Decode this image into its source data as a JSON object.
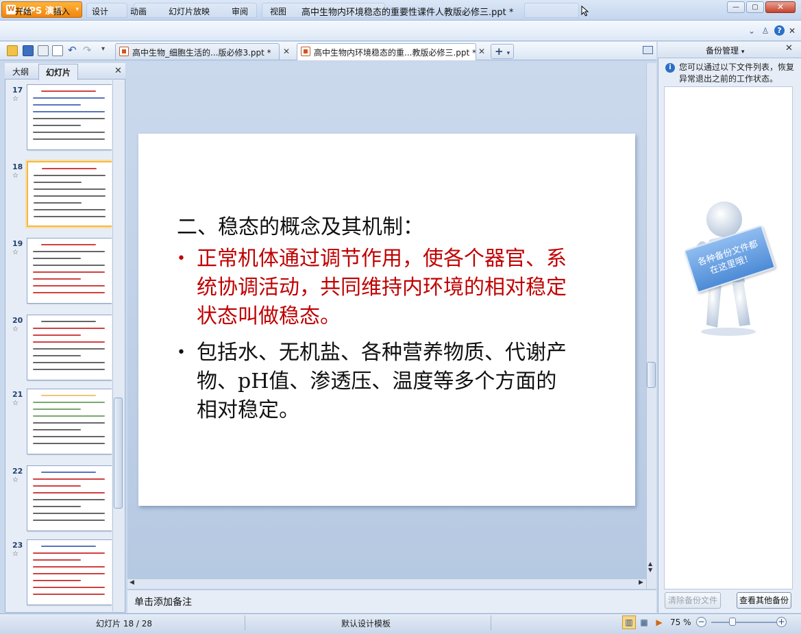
{
  "window": {
    "app_button": "WPS 演示",
    "title": "高中生物内环境稳态的重要性课件人教版必修三.ppt *"
  },
  "menu": [
    "开始",
    "插入",
    "设计",
    "动画",
    "幻灯片放映",
    "审阅",
    "视图"
  ],
  "doc_tabs": [
    {
      "label": "高中生物_细胞生活的...版必修3.ppt *",
      "active": false
    },
    {
      "label": "高中生物内环境稳态的重...教版必修三.ppt *",
      "active": true
    }
  ],
  "left_panel": {
    "tabs": [
      "大纲",
      "幻灯片"
    ],
    "active_tab": "幻灯片",
    "thumbnails": [
      {
        "number": "17",
        "selected": false
      },
      {
        "number": "18",
        "selected": true
      },
      {
        "number": "19",
        "selected": false
      },
      {
        "number": "20",
        "selected": false
      },
      {
        "number": "21",
        "selected": false
      },
      {
        "number": "22",
        "selected": false
      },
      {
        "number": "23",
        "selected": false
      }
    ]
  },
  "slide": {
    "title": "二、稳态的概念及其机制：",
    "bullets": [
      {
        "text": "正常机体通过调节作用，使各个器官、系统协调活动，共同维持内环境的相对稳定状态叫做稳态。",
        "color": "#c00000"
      },
      {
        "text": "包括水、无机盐、各种营养物质、代谢产物、pH值、渗透压、温度等多个方面的相对稳定。",
        "color": "#111111"
      }
    ]
  },
  "notes_placeholder": "单击添加备注",
  "backup_panel": {
    "title": "备份管理",
    "info": "您可以通过以下文件列表，恢复异常退出之前的工作状态。",
    "sign_text": "各种备份文件都在这里哦！",
    "clear_button": "清除备份文件",
    "other_button": "查看其他备份"
  },
  "status": {
    "slide_info": "幻灯片 18 / 28",
    "template": "默认设计模板",
    "zoom": "75 %"
  }
}
